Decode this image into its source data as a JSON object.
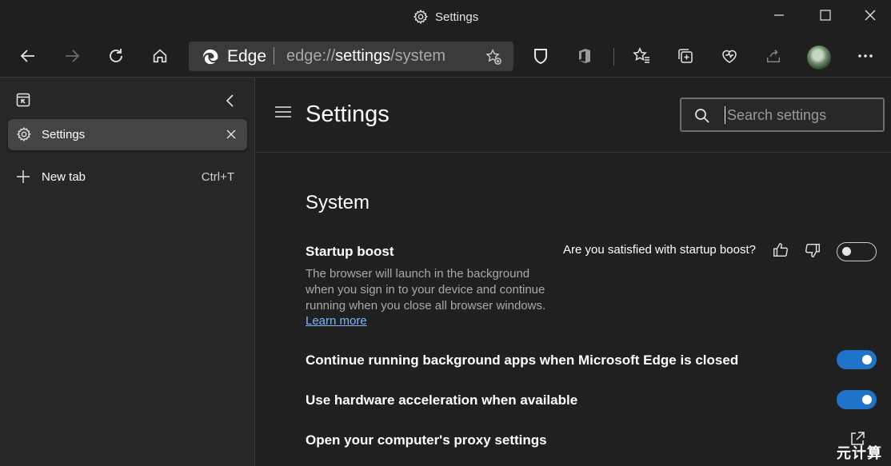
{
  "window": {
    "title": "Settings",
    "minimize_label": "—",
    "maximize_label": "☐",
    "close_label": "✕"
  },
  "toolbar": {
    "address_brand": "Edge",
    "url_prefix": "edge://",
    "url_highlight": "settings",
    "url_suffix": "/system"
  },
  "sidebar": {
    "tabs": [
      {
        "label": "Settings",
        "icon": "gear-icon",
        "active": true
      }
    ],
    "new_tab_label": "New tab",
    "new_tab_shortcut": "Ctrl+T"
  },
  "header": {
    "title": "Settings",
    "search_placeholder": "Search settings"
  },
  "system": {
    "section_title": "System",
    "startup_boost": {
      "title": "Startup boost",
      "description": "The browser will launch in the background when you sign in to your device and continue running when you close all browser windows.",
      "learn_more": "Learn more",
      "feedback_question": "Are you satisfied with startup boost?",
      "enabled": false
    },
    "background_apps": {
      "title": "Continue running background apps when Microsoft Edge is closed",
      "enabled": true
    },
    "hardware_acceleration": {
      "title": "Use hardware acceleration when available",
      "enabled": true
    },
    "proxy": {
      "title": "Open your computer's proxy settings"
    }
  },
  "watermark": "元计算",
  "colors": {
    "accent": "#1f73c9",
    "link": "#7cb7ff",
    "background": "#202020",
    "panel": "#272727"
  }
}
